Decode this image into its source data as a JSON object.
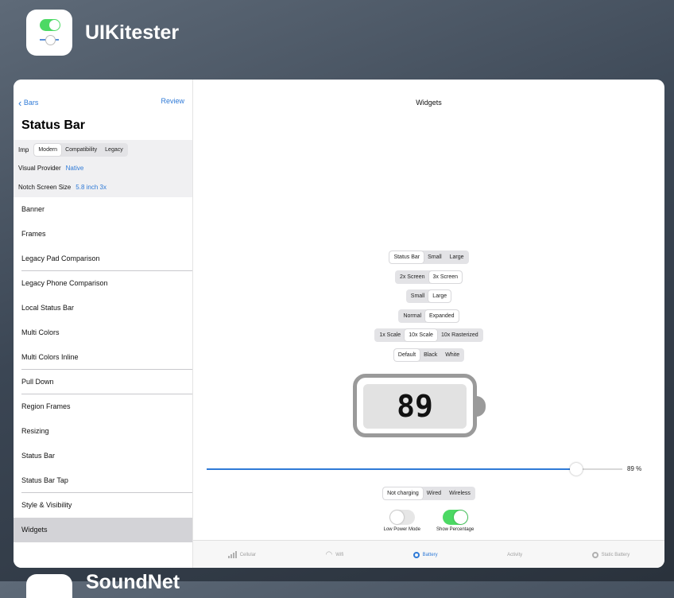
{
  "app": {
    "title": "UIKitester"
  },
  "next_app": {
    "title": "SoundNet"
  },
  "left": {
    "back_label": "Bars",
    "review_label": "Review",
    "title": "Status Bar",
    "imp_label": "Imp",
    "imp_options": [
      "Modern",
      "Compatibility",
      "Legacy"
    ],
    "visual_provider_label": "Visual Provider",
    "visual_provider_value": "Native",
    "notch_label": "Notch Screen Size",
    "notch_value": "5.8 inch 3x",
    "items": [
      "Banner",
      "Frames",
      "Legacy Pad Comparison",
      "Legacy Phone Comparison",
      "Local Status Bar",
      "Multi Colors",
      "Multi Colors Inline",
      "Pull Down",
      "Region Frames",
      "Resizing",
      "Status Bar",
      "Status Bar Tap",
      "Style & Visibility",
      "Widgets"
    ]
  },
  "right": {
    "title": "Widgets",
    "seg_kind": [
      "Status Bar",
      "Small",
      "Large"
    ],
    "seg_screen": [
      "2x Screen",
      "3x Screen"
    ],
    "seg_size": [
      "Small",
      "Large"
    ],
    "seg_mode": [
      "Normal",
      "Expanded"
    ],
    "seg_scale": [
      "1x Scale",
      "10x Scale",
      "10x Rasterized"
    ],
    "seg_color": [
      "Default",
      "Black",
      "White"
    ],
    "battery_value": "89",
    "slider_value": 0.89,
    "slider_label": "89 %",
    "seg_charging": [
      "Not charging",
      "Wired",
      "Wireless"
    ],
    "low_power_label": "Low Power Mode",
    "show_percentage_label": "Show Percentage",
    "tabs": [
      "Cellular",
      "Wifi",
      "Battery",
      "Activity",
      "Static Battery"
    ]
  },
  "colors": {
    "accent": "#2f7ad7",
    "switch_on": "#4cd964"
  }
}
